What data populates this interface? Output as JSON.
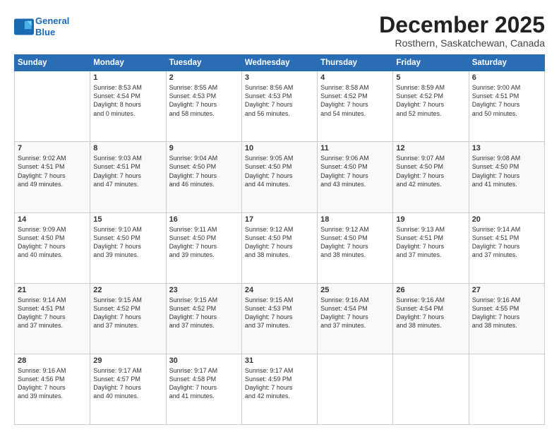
{
  "header": {
    "logo_line1": "General",
    "logo_line2": "Blue",
    "month": "December 2025",
    "location": "Rosthern, Saskatchewan, Canada"
  },
  "days_of_week": [
    "Sunday",
    "Monday",
    "Tuesday",
    "Wednesday",
    "Thursday",
    "Friday",
    "Saturday"
  ],
  "weeks": [
    [
      {
        "day": "",
        "info": ""
      },
      {
        "day": "1",
        "info": "Sunrise: 8:53 AM\nSunset: 4:54 PM\nDaylight: 8 hours\nand 0 minutes."
      },
      {
        "day": "2",
        "info": "Sunrise: 8:55 AM\nSunset: 4:53 PM\nDaylight: 7 hours\nand 58 minutes."
      },
      {
        "day": "3",
        "info": "Sunrise: 8:56 AM\nSunset: 4:53 PM\nDaylight: 7 hours\nand 56 minutes."
      },
      {
        "day": "4",
        "info": "Sunrise: 8:58 AM\nSunset: 4:52 PM\nDaylight: 7 hours\nand 54 minutes."
      },
      {
        "day": "5",
        "info": "Sunrise: 8:59 AM\nSunset: 4:52 PM\nDaylight: 7 hours\nand 52 minutes."
      },
      {
        "day": "6",
        "info": "Sunrise: 9:00 AM\nSunset: 4:51 PM\nDaylight: 7 hours\nand 50 minutes."
      }
    ],
    [
      {
        "day": "7",
        "info": "Sunrise: 9:02 AM\nSunset: 4:51 PM\nDaylight: 7 hours\nand 49 minutes."
      },
      {
        "day": "8",
        "info": "Sunrise: 9:03 AM\nSunset: 4:51 PM\nDaylight: 7 hours\nand 47 minutes."
      },
      {
        "day": "9",
        "info": "Sunrise: 9:04 AM\nSunset: 4:50 PM\nDaylight: 7 hours\nand 46 minutes."
      },
      {
        "day": "10",
        "info": "Sunrise: 9:05 AM\nSunset: 4:50 PM\nDaylight: 7 hours\nand 44 minutes."
      },
      {
        "day": "11",
        "info": "Sunrise: 9:06 AM\nSunset: 4:50 PM\nDaylight: 7 hours\nand 43 minutes."
      },
      {
        "day": "12",
        "info": "Sunrise: 9:07 AM\nSunset: 4:50 PM\nDaylight: 7 hours\nand 42 minutes."
      },
      {
        "day": "13",
        "info": "Sunrise: 9:08 AM\nSunset: 4:50 PM\nDaylight: 7 hours\nand 41 minutes."
      }
    ],
    [
      {
        "day": "14",
        "info": "Sunrise: 9:09 AM\nSunset: 4:50 PM\nDaylight: 7 hours\nand 40 minutes."
      },
      {
        "day": "15",
        "info": "Sunrise: 9:10 AM\nSunset: 4:50 PM\nDaylight: 7 hours\nand 39 minutes."
      },
      {
        "day": "16",
        "info": "Sunrise: 9:11 AM\nSunset: 4:50 PM\nDaylight: 7 hours\nand 39 minutes."
      },
      {
        "day": "17",
        "info": "Sunrise: 9:12 AM\nSunset: 4:50 PM\nDaylight: 7 hours\nand 38 minutes."
      },
      {
        "day": "18",
        "info": "Sunrise: 9:12 AM\nSunset: 4:50 PM\nDaylight: 7 hours\nand 38 minutes."
      },
      {
        "day": "19",
        "info": "Sunrise: 9:13 AM\nSunset: 4:51 PM\nDaylight: 7 hours\nand 37 minutes."
      },
      {
        "day": "20",
        "info": "Sunrise: 9:14 AM\nSunset: 4:51 PM\nDaylight: 7 hours\nand 37 minutes."
      }
    ],
    [
      {
        "day": "21",
        "info": "Sunrise: 9:14 AM\nSunset: 4:51 PM\nDaylight: 7 hours\nand 37 minutes."
      },
      {
        "day": "22",
        "info": "Sunrise: 9:15 AM\nSunset: 4:52 PM\nDaylight: 7 hours\nand 37 minutes."
      },
      {
        "day": "23",
        "info": "Sunrise: 9:15 AM\nSunset: 4:52 PM\nDaylight: 7 hours\nand 37 minutes."
      },
      {
        "day": "24",
        "info": "Sunrise: 9:15 AM\nSunset: 4:53 PM\nDaylight: 7 hours\nand 37 minutes."
      },
      {
        "day": "25",
        "info": "Sunrise: 9:16 AM\nSunset: 4:54 PM\nDaylight: 7 hours\nand 37 minutes."
      },
      {
        "day": "26",
        "info": "Sunrise: 9:16 AM\nSunset: 4:54 PM\nDaylight: 7 hours\nand 38 minutes."
      },
      {
        "day": "27",
        "info": "Sunrise: 9:16 AM\nSunset: 4:55 PM\nDaylight: 7 hours\nand 38 minutes."
      }
    ],
    [
      {
        "day": "28",
        "info": "Sunrise: 9:16 AM\nSunset: 4:56 PM\nDaylight: 7 hours\nand 39 minutes."
      },
      {
        "day": "29",
        "info": "Sunrise: 9:17 AM\nSunset: 4:57 PM\nDaylight: 7 hours\nand 40 minutes."
      },
      {
        "day": "30",
        "info": "Sunrise: 9:17 AM\nSunset: 4:58 PM\nDaylight: 7 hours\nand 41 minutes."
      },
      {
        "day": "31",
        "info": "Sunrise: 9:17 AM\nSunset: 4:59 PM\nDaylight: 7 hours\nand 42 minutes."
      },
      {
        "day": "",
        "info": ""
      },
      {
        "day": "",
        "info": ""
      },
      {
        "day": "",
        "info": ""
      }
    ]
  ]
}
